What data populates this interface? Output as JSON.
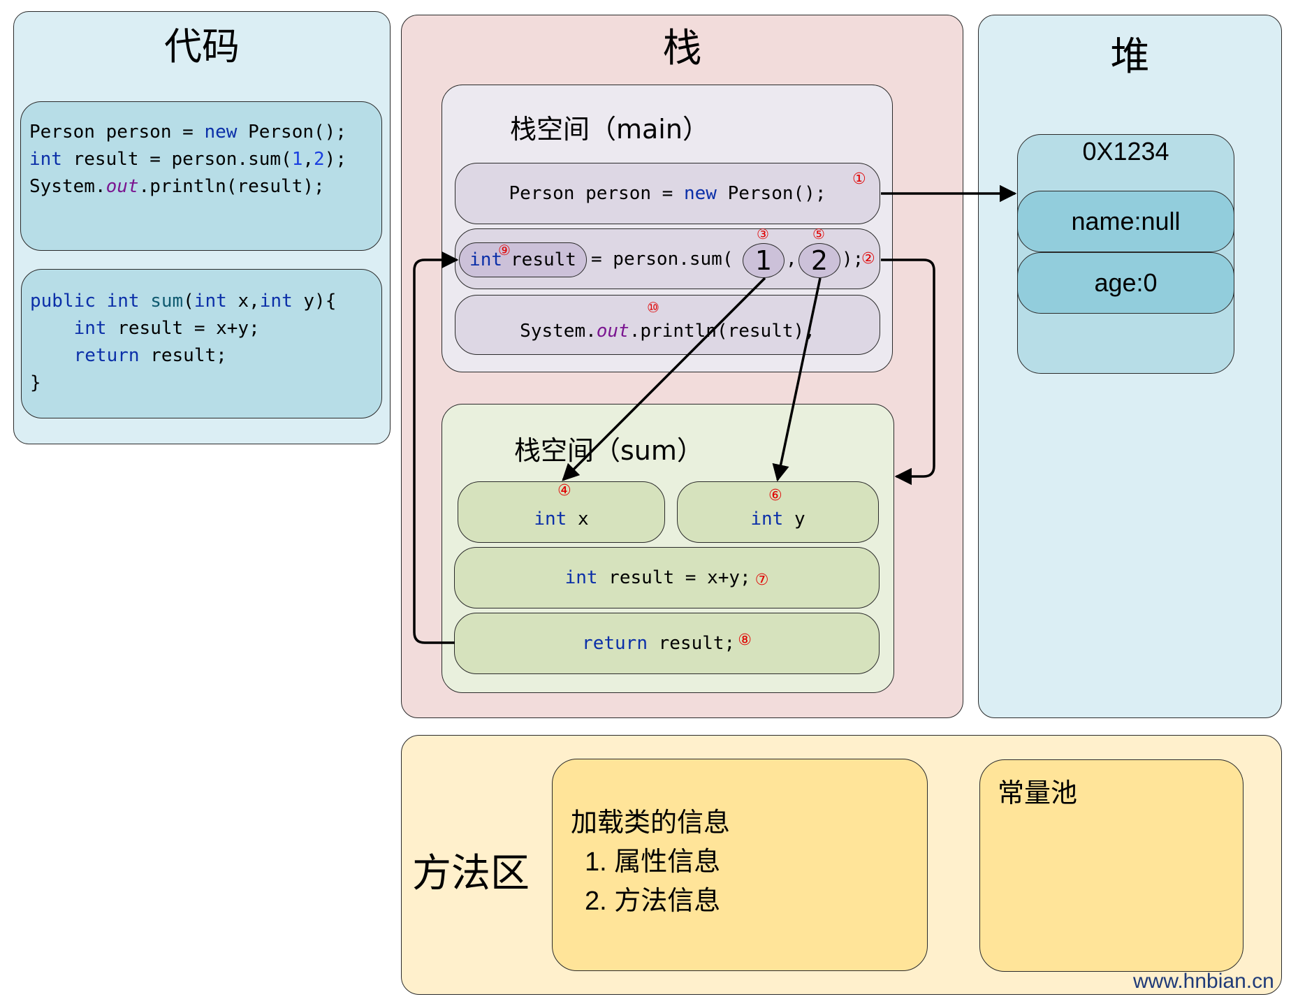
{
  "code_panel": {
    "title": "代码",
    "main_code": [
      [
        {
          "t": "Person person = ",
          "c": ""
        },
        {
          "t": "new",
          "c": "kw"
        },
        {
          "t": " Person();",
          "c": ""
        }
      ],
      [
        {
          "t": "int",
          "c": "kw"
        },
        {
          "t": " result = person.sum(",
          "c": ""
        },
        {
          "t": "1",
          "c": "num"
        },
        {
          "t": ",",
          "c": ""
        },
        {
          "t": "2",
          "c": "num"
        },
        {
          "t": ");",
          "c": ""
        }
      ],
      [
        {
          "t": "System.",
          "c": ""
        },
        {
          "t": "out",
          "c": "it"
        },
        {
          "t": ".println(result);",
          "c": ""
        }
      ]
    ],
    "sum_code": [
      [
        {
          "t": "public",
          "c": "kw"
        },
        {
          "t": " ",
          "c": ""
        },
        {
          "t": "int",
          "c": "kw"
        },
        {
          "t": " ",
          "c": ""
        },
        {
          "t": "sum",
          "c": "fn"
        },
        {
          "t": "(",
          "c": ""
        },
        {
          "t": "int",
          "c": "kw"
        },
        {
          "t": " x,",
          "c": ""
        },
        {
          "t": "int",
          "c": "kw"
        },
        {
          "t": " y){",
          "c": ""
        }
      ],
      [
        {
          "t": "    ",
          "c": ""
        },
        {
          "t": "int",
          "c": "kw"
        },
        {
          "t": " result = x+y;",
          "c": ""
        }
      ],
      [
        {
          "t": "    ",
          "c": ""
        },
        {
          "t": "return",
          "c": "kw"
        },
        {
          "t": " result;",
          "c": ""
        }
      ],
      [
        {
          "t": "}",
          "c": ""
        }
      ]
    ]
  },
  "stack_panel": {
    "title": "栈",
    "main_frame": {
      "title": "栈空间（main）",
      "row_new": {
        "prefix": "Person person = ",
        "keyword": "new",
        "suffix": " Person();",
        "step": "①"
      },
      "row_call": {
        "result_keyword": "int",
        "result_name": "result",
        "result_step": "⑨",
        "middle": "= person.sum(",
        "arg1": "1",
        "arg1_step": "③",
        "comma": ",",
        "arg2": "2",
        "arg2_step": "⑤",
        "suffix": ");",
        "step": "②"
      },
      "row_print": {
        "prefix": "System.",
        "italic": "out",
        "suffix": ".println(result);",
        "step": "⑩"
      }
    },
    "sum_frame": {
      "title": "栈空间（sum）",
      "param_x": {
        "keyword": "int",
        "name": " x",
        "step": "④"
      },
      "param_y": {
        "keyword": "int",
        "name": " y",
        "step": "⑥"
      },
      "row_add": {
        "keyword": "int",
        "rest": " result = x+y;",
        "step": "⑦"
      },
      "row_return": {
        "keyword": "return",
        "rest": " result;",
        "step": "⑧"
      }
    }
  },
  "heap_panel": {
    "title": "堆",
    "object": {
      "address": "0X1234",
      "fields": [
        "name:null",
        "age:0"
      ]
    }
  },
  "method_area": {
    "title": "方法区",
    "class_info": {
      "heading": "加载类的信息",
      "items": [
        "1. 属性信息",
        "2. 方法信息"
      ]
    },
    "constant_pool": {
      "title": "常量池"
    }
  },
  "watermark": "www.hnbian.cn",
  "colors": {
    "keyword": "#0b2fa8",
    "number": "#1a3fe0",
    "italic_field": "#7a1590",
    "step_marker": "#e00000",
    "code_bg": "#dbeef4",
    "stack_bg": "#f2dcdb",
    "heap_bg": "#dbeef4",
    "method_bg": "#fff0cc"
  }
}
